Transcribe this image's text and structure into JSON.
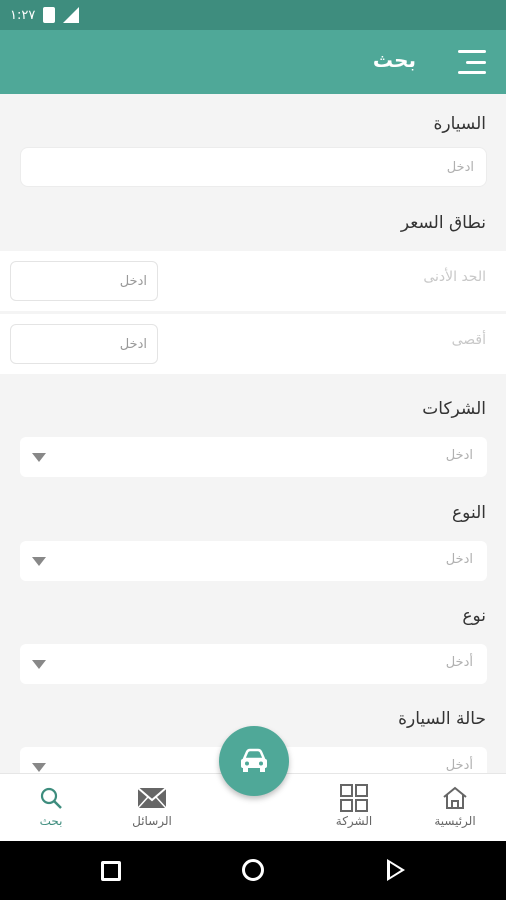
{
  "status_bar": {
    "time": "١:٢٧"
  },
  "app_bar": {
    "title": "بحث"
  },
  "form": {
    "car_label": "السيارة",
    "car_placeholder": "ادخل",
    "price_label": "نطاق السعر",
    "min_label": "الحد الأدنى",
    "min_placeholder": "ادخل",
    "max_label": "أقصى",
    "max_placeholder": "ادخل",
    "companies_label": "الشركات",
    "companies_placeholder": "ادخل",
    "type_label": "النوع",
    "type_placeholder": "ادخل",
    "kind_label": "نوع",
    "kind_placeholder": "أدخل",
    "condition_label": "حالة السيارة",
    "condition_placeholder": "أدخل"
  },
  "bottom_nav": {
    "home": "الرئيسية",
    "company": "الشركة",
    "messages": "الرسائل",
    "search": "بحث"
  },
  "colors": {
    "primary": "#4fa898",
    "status": "#3e8d7e"
  }
}
